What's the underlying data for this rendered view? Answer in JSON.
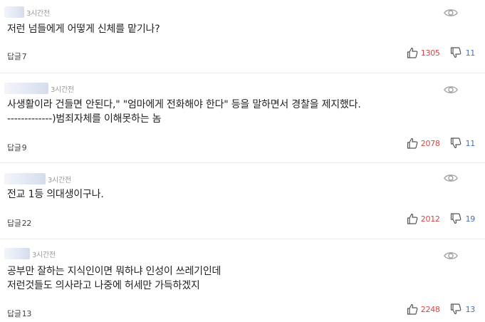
{
  "colors": {
    "like": "#d64545",
    "dislike": "#3b6fc9",
    "meta": "#9a9a9a"
  },
  "icons": {
    "view": "eye-icon",
    "like": "thumbs-up-icon",
    "dislike": "thumbs-down-icon"
  },
  "comments": [
    {
      "time": "3시간전",
      "text": "저런 넘들에게 어떻게 신체를 맡기나?",
      "reply_label": "답글",
      "reply_count": "7",
      "likes": "1305",
      "dislikes": "11"
    },
    {
      "time": "3시간전",
      "text": "사생활이라 건들면 안된다,\" \"엄마에게 전화해야 한다\" 등을 말하면서 경찰을 제지했다.\n-------------)범죄자체를 이해못하는 놈",
      "reply_label": "답글",
      "reply_count": "9",
      "likes": "2078",
      "dislikes": "11"
    },
    {
      "time": "3시간전",
      "text": "전교 1등 의대생이구나.",
      "reply_label": "답글",
      "reply_count": "22",
      "likes": "2012",
      "dislikes": "19"
    },
    {
      "time": "3시간전",
      "text": "공부만 잘하는 지식인이면 뭐하냐 인성이 쓰레기인데\n저런것들도 의사라고 나중에 허세만 가득하겠지",
      "reply_label": "답글",
      "reply_count": "13",
      "likes": "2248",
      "dislikes": "13"
    }
  ]
}
